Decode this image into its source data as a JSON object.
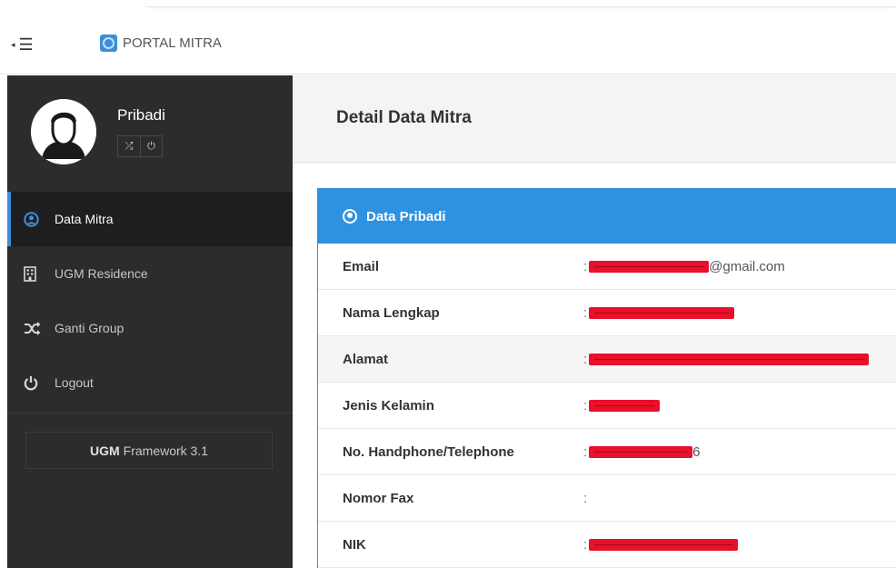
{
  "navbar": {
    "brand": "PORTAL MITRA",
    "toggle_icon": "hamburger-icon"
  },
  "sidebar": {
    "profile": {
      "name": "Pribadi",
      "actions": [
        {
          "icon": "shuffle-icon",
          "glyph": "⤮"
        },
        {
          "icon": "power-icon",
          "glyph": "⏻"
        }
      ]
    },
    "items": [
      {
        "label": "Data Mitra",
        "icon": "user-circle-icon",
        "glyph": "◉",
        "active": true
      },
      {
        "label": "UGM Residence",
        "icon": "building-icon",
        "glyph": "▦",
        "active": false
      },
      {
        "label": "Ganti Group",
        "icon": "shuffle-icon",
        "glyph": "⤮",
        "active": false
      },
      {
        "label": "Logout",
        "icon": "power-icon",
        "glyph": "⏻",
        "active": false
      }
    ],
    "framework": {
      "bold": "UGM",
      "rest": "Framework 3.1"
    }
  },
  "main": {
    "title": "Detail Data Mitra",
    "panel": {
      "title": "Data Pribadi",
      "rows": [
        {
          "label": "Email",
          "value": "@gmail.com"
        },
        {
          "label": "Nama Lengkap",
          "value": ""
        },
        {
          "label": "Alamat",
          "value": ""
        },
        {
          "label": "Jenis Kelamin",
          "value": ""
        },
        {
          "label": "No. Handphone/Telephone",
          "value": "6"
        },
        {
          "label": "Nomor Fax",
          "value": ""
        },
        {
          "label": "NIK",
          "value": ""
        }
      ]
    }
  },
  "colors": {
    "accent": "#2f92e0",
    "sidebar_bg": "#2b2c2e",
    "redaction": "#e8102a"
  }
}
